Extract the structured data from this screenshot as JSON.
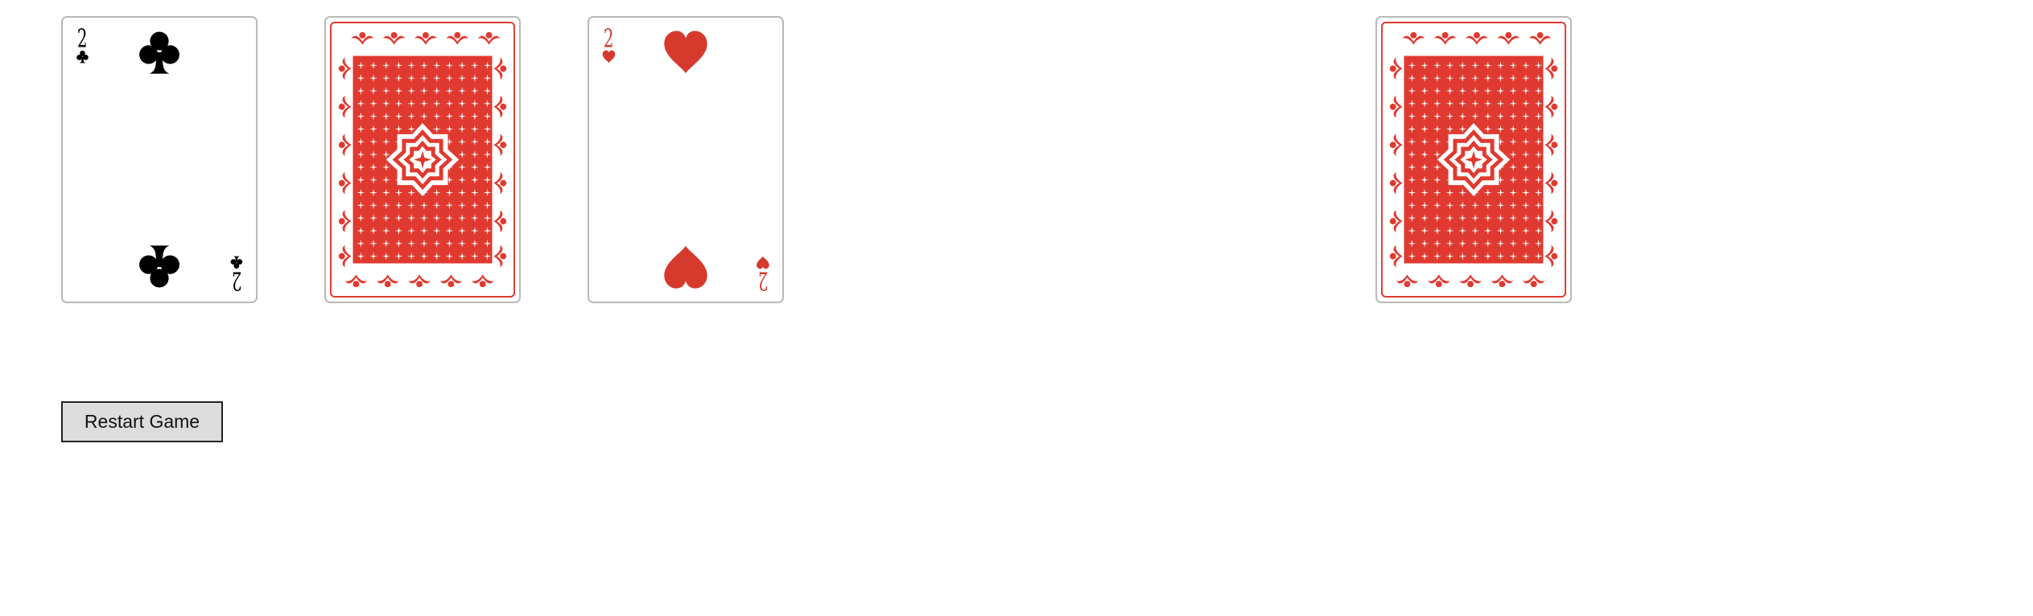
{
  "tableau": {
    "cards": [
      {
        "state": "face-up",
        "rank": "2",
        "suit": "clubs",
        "suit_color": "#000000",
        "suit_icon": "club-icon"
      },
      {
        "state": "face-down",
        "back_color": "#e03a30",
        "back_icon": "card-back-pattern"
      },
      {
        "state": "face-up",
        "rank": "2",
        "suit": "hearts",
        "suit_color": "#d63a2d",
        "suit_icon": "heart-icon"
      },
      {
        "state": "face-down",
        "back_color": "#e03a30",
        "back_icon": "card-back-pattern"
      }
    ]
  },
  "controls": {
    "restart_label": "Restart Game"
  }
}
